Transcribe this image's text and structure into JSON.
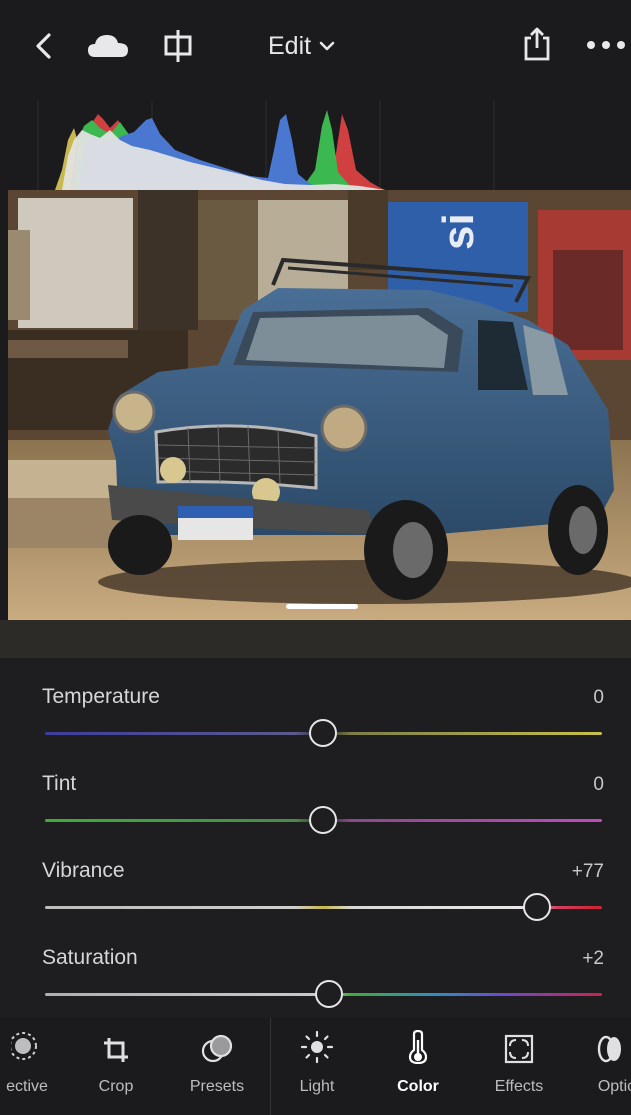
{
  "header": {
    "edit_label": "Edit"
  },
  "icons": {
    "back": "chevron-left-icon",
    "cloud": "cloud-icon",
    "compare": "compare-split-icon",
    "share": "share-icon",
    "more": "more-dots-icon"
  },
  "sliders": [
    {
      "label": "Temperature",
      "value": "0",
      "level": 0.5
    },
    {
      "label": "Tint",
      "value": "0",
      "level": 0.5
    },
    {
      "label": "Vibrance",
      "value": "+77",
      "level": 0.885
    },
    {
      "label": "Saturation",
      "value": "+2",
      "level": 0.51
    }
  ],
  "toolbar": {
    "items": [
      {
        "label": "ective",
        "icon": "selective-icon"
      },
      {
        "label": "Crop",
        "icon": "crop-icon"
      },
      {
        "label": "Presets",
        "icon": "presets-icon"
      },
      {
        "label": "Light",
        "icon": "sun-icon"
      },
      {
        "label": "Color",
        "icon": "thermometer-icon",
        "active": true
      },
      {
        "label": "Effects",
        "icon": "effects-icon"
      },
      {
        "label": "Optic",
        "icon": "optics-icon"
      }
    ]
  },
  "colors": {
    "background": "#1b1b1d",
    "panel": "#1e1e20",
    "active_label": "#ffffff"
  }
}
